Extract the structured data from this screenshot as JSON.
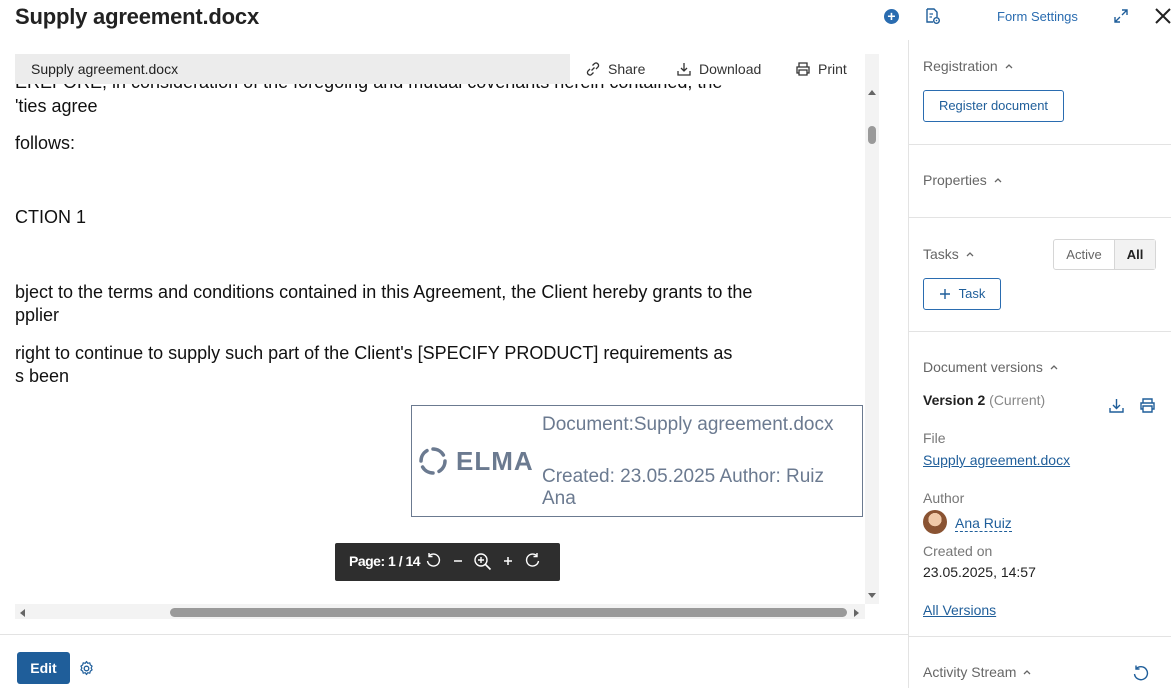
{
  "header": {
    "title": "Supply agreement.docx",
    "form_settings": "Form Settings"
  },
  "viewer": {
    "file_name": "Supply agreement.docx",
    "actions": {
      "share": "Share",
      "download": "Download",
      "print": "Print"
    },
    "page_label": "Page: 1 / 14",
    "document_lines": [
      "EREFORE, in consideration of the foregoing and mutual covenants herein contained, the",
      "'ties agree",
      "follows:",
      "CTION 1",
      "bject to the terms and conditions contained in this Agreement, the Client hereby grants to the",
      "pplier",
      " right to continue to supply such part of the Client's [SPECIFY PRODUCT] requirements as",
      "s been"
    ],
    "stamp": {
      "logo_text": "ELMA",
      "document": "Document:Supply agreement.docx",
      "created_line1": "Created: 23.05.2025 Author: Ruiz",
      "created_line2": "Ana"
    }
  },
  "footer": {
    "edit_label": "Edit"
  },
  "sidebar": {
    "registration": {
      "title": "Registration",
      "button": "Register document"
    },
    "properties": {
      "title": "Properties"
    },
    "tasks": {
      "title": "Tasks",
      "filter_active": "Active",
      "filter_all": "All",
      "add_task": "Task"
    },
    "versions": {
      "title": "Document versions",
      "version": "Version 2",
      "current": "(Current)",
      "file_label": "File",
      "file_link": "Supply agreement.docx",
      "author_label": "Author",
      "author": "Ana Ruiz",
      "created_label": "Created on",
      "created_value": "23.05.2025, 14:57",
      "all_versions": "All Versions"
    },
    "activity": {
      "title": "Activity Stream"
    }
  },
  "colors": {
    "accent": "#1f5e9a",
    "link": "#2a6cb0",
    "stamp": "#6b7a90"
  }
}
